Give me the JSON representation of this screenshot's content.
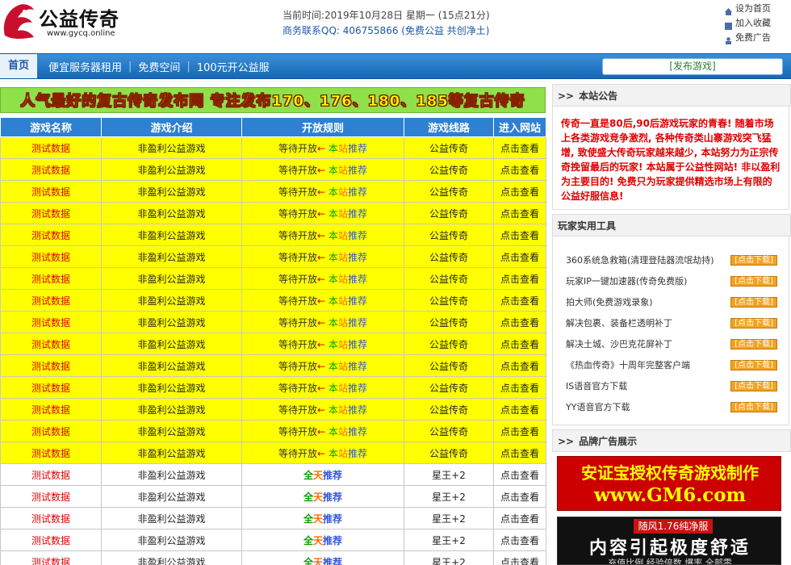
{
  "header": {
    "logo_text": "公益传奇",
    "logo_url": "www.gycq.online",
    "time_text": "当前时间:2019年10月28日  星期一  (15点21分)",
    "contact_text": "商务联系QQ: 406755866   (免费公益  共创净土)",
    "links": [
      "设为首页",
      "加入收藏",
      "免费广告"
    ]
  },
  "nav": {
    "home": "首页",
    "items": [
      "便宜服务器租用",
      "免费空间",
      "100元开公益服"
    ],
    "publish": "[发布游戏]"
  },
  "banner": "人气最好的复古传奇发布网   专注发布170、176、180、185等复古传奇",
  "table": {
    "headers": [
      "游戏名称",
      "游戏介绍",
      "开放规则",
      "游戏线路",
      "进入网站"
    ],
    "rows": [
      {
        "name": "测试数据",
        "desc": "非盈利公益游戏",
        "rule_main": "等待开放",
        "arrow": "←",
        "ben": "本",
        "zhan": "站",
        "tui": "推荐",
        "line": "公益传奇",
        "enter": "点击查看",
        "highlight": true
      },
      {
        "name": "测试数据",
        "desc": "非盈利公益游戏",
        "rule_main": "等待开放",
        "arrow": "←",
        "ben": "本",
        "zhan": "站",
        "tui": "推荐",
        "line": "公益传奇",
        "enter": "点击查看",
        "highlight": true
      },
      {
        "name": "测试数据",
        "desc": "非盈利公益游戏",
        "rule_main": "等待开放",
        "arrow": "←",
        "ben": "本",
        "zhan": "站",
        "tui": "推荐",
        "line": "公益传奇",
        "enter": "点击查看",
        "highlight": true
      },
      {
        "name": "测试数据",
        "desc": "非盈利公益游戏",
        "rule_main": "等待开放",
        "arrow": "←",
        "ben": "本",
        "zhan": "站",
        "tui": "推荐",
        "line": "公益传奇",
        "enter": "点击查看",
        "highlight": true
      },
      {
        "name": "测试数据",
        "desc": "非盈利公益游戏",
        "rule_main": "等待开放",
        "arrow": "←",
        "ben": "本",
        "zhan": "站",
        "tui": "推荐",
        "line": "公益传奇",
        "enter": "点击查看",
        "highlight": true
      },
      {
        "name": "测试数据",
        "desc": "非盈利公益游戏",
        "rule_main": "等待开放",
        "arrow": "←",
        "ben": "本",
        "zhan": "站",
        "tui": "推荐",
        "line": "公益传奇",
        "enter": "点击查看",
        "highlight": true
      },
      {
        "name": "测试数据",
        "desc": "非盈利公益游戏",
        "rule_main": "等待开放",
        "arrow": "←",
        "ben": "本",
        "zhan": "站",
        "tui": "推荐",
        "line": "公益传奇",
        "enter": "点击查看",
        "highlight": true
      },
      {
        "name": "测试数据",
        "desc": "非盈利公益游戏",
        "rule_main": "等待开放",
        "arrow": "←",
        "ben": "本",
        "zhan": "站",
        "tui": "推荐",
        "line": "公益传奇",
        "enter": "点击查看",
        "highlight": true
      },
      {
        "name": "测试数据",
        "desc": "非盈利公益游戏",
        "rule_main": "等待开放",
        "arrow": "←",
        "ben": "本",
        "zhan": "站",
        "tui": "推荐",
        "line": "公益传奇",
        "enter": "点击查看",
        "highlight": true
      },
      {
        "name": "测试数据",
        "desc": "非盈利公益游戏",
        "rule_main": "等待开放",
        "arrow": "←",
        "ben": "本",
        "zhan": "站",
        "tui": "推荐",
        "line": "公益传奇",
        "enter": "点击查看",
        "highlight": true
      },
      {
        "name": "测试数据",
        "desc": "非盈利公益游戏",
        "rule_main": "等待开放",
        "arrow": "←",
        "ben": "本",
        "zhan": "站",
        "tui": "推荐",
        "line": "公益传奇",
        "enter": "点击查看",
        "highlight": true
      },
      {
        "name": "测试数据",
        "desc": "非盈利公益游戏",
        "rule_main": "等待开放",
        "arrow": "←",
        "ben": "本",
        "zhan": "站",
        "tui": "推荐",
        "line": "公益传奇",
        "enter": "点击查看",
        "highlight": true
      },
      {
        "name": "测试数据",
        "desc": "非盈利公益游戏",
        "rule_main": "等待开放",
        "arrow": "←",
        "ben": "本",
        "zhan": "站",
        "tui": "推荐",
        "line": "公益传奇",
        "enter": "点击查看",
        "highlight": true
      },
      {
        "name": "测试数据",
        "desc": "非盈利公益游戏",
        "rule_main": "等待开放",
        "arrow": "←",
        "ben": "本",
        "zhan": "站",
        "tui": "推荐",
        "line": "公益传奇",
        "enter": "点击查看",
        "highlight": true
      },
      {
        "name": "测试数据",
        "desc": "非盈利公益游戏",
        "rule_main": "等待开放",
        "arrow": "←",
        "ben": "本",
        "zhan": "站",
        "tui": "推荐",
        "line": "公益传奇",
        "enter": "点击查看",
        "highlight": true
      },
      {
        "name": "测试数据",
        "desc": "非盈利公益游戏",
        "rule_main": "",
        "arrow": "",
        "ben": "全",
        "zhan": "天",
        "tui": "推荐",
        "line": "星王+2",
        "enter": "点击查看",
        "highlight": false
      },
      {
        "name": "测试数据",
        "desc": "非盈利公益游戏",
        "rule_main": "",
        "arrow": "",
        "ben": "全",
        "zhan": "天",
        "tui": "推荐",
        "line": "星王+2",
        "enter": "点击查看",
        "highlight": false
      },
      {
        "name": "测试数据",
        "desc": "非盈利公益游戏",
        "rule_main": "",
        "arrow": "",
        "ben": "全",
        "zhan": "天",
        "tui": "推荐",
        "line": "星王+2",
        "enter": "点击查看",
        "highlight": false
      },
      {
        "name": "测试数据",
        "desc": "非盈利公益游戏",
        "rule_main": "",
        "arrow": "",
        "ben": "全",
        "zhan": "天",
        "tui": "推荐",
        "line": "星王+2",
        "enter": "点击查看",
        "highlight": false
      },
      {
        "name": "测试数据",
        "desc": "非盈利公益游戏",
        "rule_main": "",
        "arrow": "",
        "ben": "全",
        "zhan": "天",
        "tui": "推荐",
        "line": "星王+2",
        "enter": "点击查看",
        "highlight": false
      }
    ]
  },
  "sidebar": {
    "notice_title": "本站公告",
    "notice_text": "传奇一直是80后,90后游戏玩家的青春! 随着市场上各类游戏竞争激烈, 各种传奇类山寨游戏突飞猛增, 致使盛大传奇玩家越来越少, 本站努力为正宗传奇挽留最后的玩家! 本站属于公益性网站! 非以盈利为主要目的! 免费只为玩家提供精选市场上有限的公益好服信息!",
    "tools_title": "玩家实用工具",
    "tools": [
      {
        "label": "360系统急救箱(清理登陆器流氓劫持)",
        "button": "[点击下载]"
      },
      {
        "label": "玩家IP一键加速器(传奇免费版)",
        "button": "[点击下载]"
      },
      {
        "label": "拍大师(免费游戏录象)",
        "button": "[点击下载]"
      },
      {
        "label": "解决包裹、装备栏透明补丁",
        "button": "[点击下载]"
      },
      {
        "label": "解决土城、沙巴克花屏补丁",
        "button": "[点击下载]"
      },
      {
        "label": "《热血传奇》十周年完整客户端",
        "button": "[点击下载]"
      },
      {
        "label": "IS语音官方下载",
        "button": "[点击下载]"
      },
      {
        "label": "YY语音官方下载",
        "button": "[点击下载]"
      }
    ],
    "brand_title": "品牌广告展示",
    "ad1_line1": "安证宝授权传奇游戏制作",
    "ad1_line2": "www.GM6.com",
    "ad2_tag": "随风1.76纯净服",
    "ad2_line": "内容引起极度舒适",
    "ad2_sub": "充值比例 经验倍数 爆率 全部零"
  }
}
